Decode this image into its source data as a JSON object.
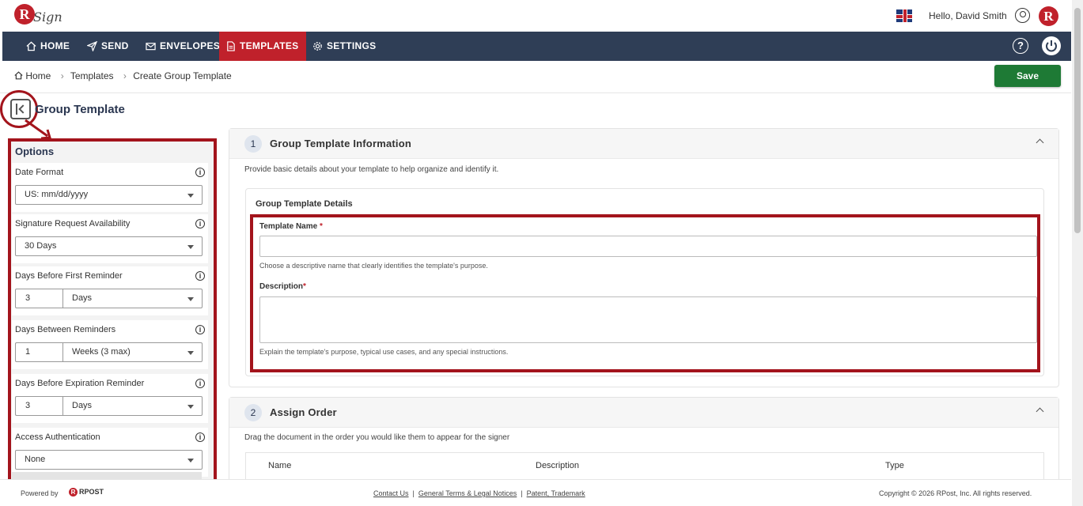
{
  "header": {
    "greeting": "Hello, David Smith",
    "brand_letter": "R",
    "logo_text": "Sign"
  },
  "nav": {
    "items": [
      {
        "label": "HOME",
        "icon": "home-icon"
      },
      {
        "label": "SEND",
        "icon": "send-icon"
      },
      {
        "label": "ENVELOPES",
        "icon": "envelope-icon"
      },
      {
        "label": "TEMPLATES",
        "icon": "document-icon",
        "active": true
      },
      {
        "label": "SETTINGS",
        "icon": "gear-icon"
      }
    ],
    "help_label": "?"
  },
  "breadcrumb": {
    "home": "Home",
    "templates": "Templates",
    "current": "Create Group Template"
  },
  "toolbar": {
    "save_label": "Save"
  },
  "page": {
    "title": "Group Template"
  },
  "options": {
    "title": "Options",
    "date_format": {
      "label": "Date Format",
      "value": "US: mm/dd/yyyy"
    },
    "availability": {
      "label": "Signature Request Availability",
      "value": "30 Days"
    },
    "first_reminder": {
      "label": "Days Before First Reminder",
      "number": "3",
      "unit": "Days"
    },
    "between_reminders": {
      "label": "Days Between Reminders",
      "number": "1",
      "unit": "Weeks (3 max)"
    },
    "expiration_reminder": {
      "label": "Days Before Expiration Reminder",
      "number": "3",
      "unit": "Days"
    },
    "access_auth": {
      "label": "Access Authentication",
      "value": "None"
    }
  },
  "section1": {
    "number": "1",
    "title": "Group Template Information",
    "description": "Provide basic details about your template to help organize and identify it.",
    "details_title": "Group Template Details",
    "name_label": "Template Name",
    "name_required": "*",
    "name_hint": "Choose a descriptive name that clearly identifies the template's purpose.",
    "desc_label": "Description",
    "desc_required": "*",
    "desc_hint": "Explain the template's purpose, typical use cases, and any special instructions."
  },
  "section2": {
    "number": "2",
    "title": "Assign Order",
    "description": "Drag the document in the order you would like them to appear for the signer",
    "columns": [
      "Name",
      "Description",
      "Type"
    ]
  },
  "footer": {
    "powered_by": "Powered by",
    "rpost": "RPOST",
    "links": [
      "Contact Us",
      "General Terms & Legal Notices",
      "Patent, Trademark"
    ],
    "copyright": "Copyright © 2026 RPost, Inc. All rights reserved."
  },
  "colors": {
    "nav_bg": "#2f3e56",
    "accent_red": "#c0212b",
    "save_green": "#1e7a35",
    "annotation_red": "#a3141c"
  }
}
